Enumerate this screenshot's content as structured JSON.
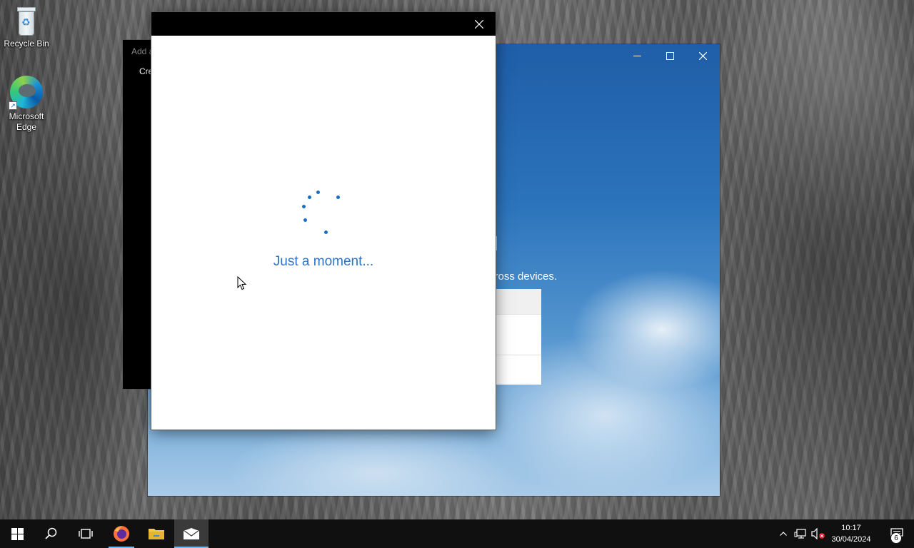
{
  "desktop": {
    "icons": [
      {
        "label": "Recycle Bin"
      },
      {
        "label": "Microsoft Edge"
      }
    ]
  },
  "mail_window": {
    "heading_fragment": "il",
    "subtitle_fragment": "cross devices."
  },
  "add_account_window": {
    "title_fragment": "Add a",
    "item_fragment": "Cre"
  },
  "dialog": {
    "loading_text": "Just a moment..."
  },
  "taskbar": {
    "apps": [
      "start-icon",
      "search-icon",
      "task-view-icon",
      "firefox-icon",
      "file-explorer-icon",
      "mail-icon"
    ],
    "clock_time": "10:17",
    "clock_date": "30/04/2024",
    "notification_count": "6"
  }
}
